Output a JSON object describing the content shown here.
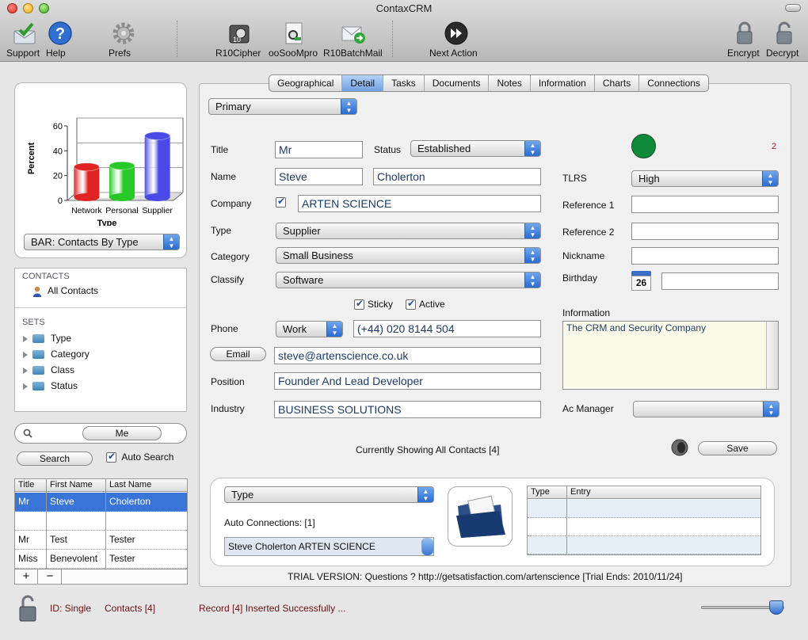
{
  "window": {
    "title": "ContaxCRM"
  },
  "toolbar": {
    "items": [
      {
        "label": "Support",
        "icon": "support-icon"
      },
      {
        "label": "Help",
        "icon": "help-icon"
      },
      {
        "label": "Prefs",
        "icon": "gear-icon"
      },
      {
        "label": "R10Cipher",
        "icon": "cipher-icon"
      },
      {
        "label": "ooSooMpro",
        "icon": "oosoompro-icon"
      },
      {
        "label": "R10BatchMail",
        "icon": "batchmail-icon"
      },
      {
        "label": "Next Action",
        "icon": "next-action-icon"
      },
      {
        "label": "Encrypt",
        "icon": "lock-icon"
      },
      {
        "label": "Decrypt",
        "icon": "unlock-icon"
      }
    ]
  },
  "chart_data": {
    "type": "bar",
    "categories": [
      "Network",
      "Personal",
      "Supplier"
    ],
    "values": [
      27,
      28,
      52
    ],
    "ylabel": "Percent",
    "xlabel": "Type",
    "ylim": [
      0,
      60
    ],
    "yticks": [
      "0",
      "20",
      "40",
      "60"
    ],
    "colors": [
      "#e02424",
      "#27c927",
      "#4a4ae6"
    ],
    "grid": true
  },
  "chart_selector": {
    "value": "BAR: Contacts By Type"
  },
  "sources": {
    "contacts_header": "CONTACTS",
    "all_contacts": "All Contacts",
    "sets_header": "SETS",
    "sets": [
      "Type",
      "Category",
      "Class",
      "Status"
    ]
  },
  "search": {
    "field_value": "Me",
    "button_label": "Search",
    "auto_search_label": "Auto Search"
  },
  "contacts_table": {
    "columns": [
      "Title",
      "First Name",
      "Last Name"
    ],
    "rows": [
      {
        "title": "Mr",
        "first": "Steve",
        "last": "Cholerton",
        "selected": true
      },
      {
        "title": "",
        "first": "",
        "last": "",
        "selected": false
      },
      {
        "title": "Mr",
        "first": "Test",
        "last": "Tester",
        "selected": false
      },
      {
        "title": "Miss",
        "first": "Benevolent",
        "last": "Tester",
        "selected": false
      }
    ],
    "add_label": "+",
    "remove_label": "−"
  },
  "tabs": [
    "Geographical",
    "Detail",
    "Tasks",
    "Documents",
    "Notes",
    "Information",
    "Charts",
    "Connections"
  ],
  "active_tab": "Detail",
  "detail": {
    "address_type": "Primary",
    "labels": {
      "title": "Title",
      "status": "Status",
      "name": "Name",
      "company": "Company",
      "type": "Type",
      "category": "Category",
      "classify": "Classify",
      "phone": "Phone",
      "email_button": "Email",
      "position": "Position",
      "industry": "Industry",
      "tlrs": "TLRS",
      "reference1": "Reference 1",
      "reference2": "Reference 2",
      "nickname": "Nickname",
      "birthday": "Birthday",
      "information": "Information",
      "ac_manager": "Ac Manager",
      "sticky": "Sticky",
      "active": "Active"
    },
    "values": {
      "title": "Mr",
      "status": "Established",
      "first_name": "Steve",
      "last_name": "Cholerton",
      "company": "ARTEN SCIENCE",
      "type": "Supplier",
      "category": "Small Business",
      "classify": "Software",
      "phone_type": "Work",
      "phone": "(+44) 020 8144 504",
      "email": "steve@artenscience.co.uk",
      "position": "Founder And Lead Developer",
      "industry": "BUSINESS SOLUTIONS",
      "tlrs": "High",
      "reference1": "",
      "reference2": "",
      "nickname": "",
      "birthday": "",
      "information": "The CRM and Security Company",
      "ac_manager": "",
      "record_number": "2",
      "calendar_day": "26"
    },
    "status_color": "#0f8a3a",
    "showing": "Currently Showing All Contacts  [4]",
    "save_label": "Save"
  },
  "connections": {
    "type_selector": "Type",
    "auto_label": "Auto Connections: [1]",
    "items": [
      "Steve Cholerton ARTEN SCIENCE"
    ],
    "entry_columns": [
      "Type",
      "Entry"
    ]
  },
  "trial": "TRIAL VERSION:  Questions ?  http://getsatisfaction.com/artenscience   [Trial Ends: 2010/11/24]",
  "statusbar": {
    "id": "ID: Single",
    "contacts": "Contacts [4]",
    "message": "Record [4] Inserted Successfully ...",
    "slider_level": 0.9
  }
}
